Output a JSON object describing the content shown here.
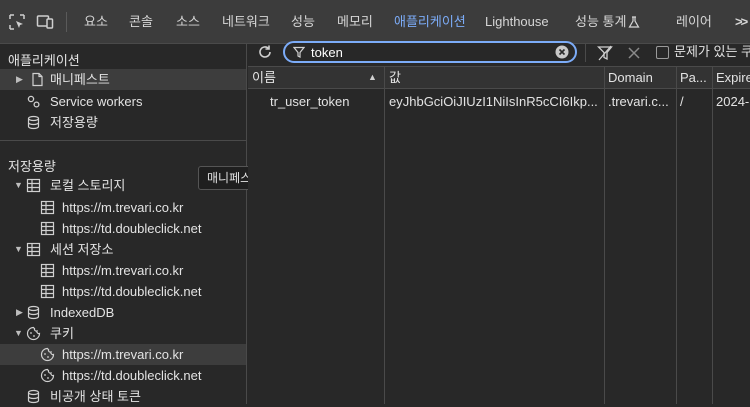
{
  "tabs": {
    "items": [
      "요소",
      "콘솔",
      "소스",
      "네트워크",
      "성능",
      "메모리",
      "애플리케이션",
      "Lighthouse",
      "성능 통계",
      "레이어"
    ],
    "overflow_label": ">>"
  },
  "sidebar": {
    "app_section_title": "애플리케이션",
    "app_items": {
      "manifest": "매니페스트",
      "service_workers": "Service workers",
      "storage": "저장용량"
    },
    "storage_section_title": "저장용량",
    "local_storage": {
      "label": "로컬 스토리지",
      "children": [
        "https://m.trevari.co.kr",
        "https://td.doubleclick.net"
      ]
    },
    "session_storage": {
      "label": "세션 저장소",
      "children": [
        "https://m.trevari.co.kr",
        "https://td.doubleclick.net"
      ]
    },
    "indexeddb": "IndexedDB",
    "cookies": {
      "label": "쿠키",
      "children": [
        "https://m.trevari.co.kr",
        "https://td.doubleclick.net"
      ]
    },
    "private_state_tokens": "비공개 상태 토큰"
  },
  "tooltip": "매니페스트",
  "toolbar": {
    "filter_value": "token",
    "issues_checkbox_label": "문제가 있는 쿠키"
  },
  "grid": {
    "headers": {
      "name": "이름",
      "value": "값",
      "domain": "Domain",
      "path": "Pa...",
      "expires": "Expire"
    },
    "rows": [
      {
        "name": "tr_user_token",
        "value": "eyJhbGciOiJIUzI1NiIsInR5cCI6Ikp...",
        "domain": ".trevari.c...",
        "path": "/",
        "expires": "2024-..."
      }
    ]
  },
  "colors": {
    "accent": "#7cacf8",
    "background": "#282828",
    "toolbar_bg": "#3c3c3c"
  }
}
